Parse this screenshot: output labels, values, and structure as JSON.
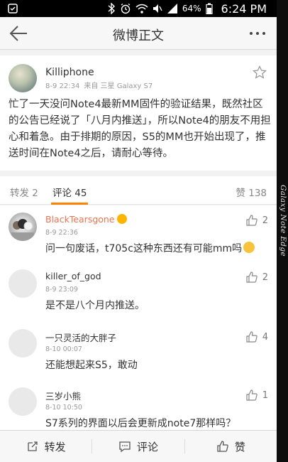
{
  "status_bar": {
    "battery": "64%",
    "time": "6:24 PM"
  },
  "header": {
    "title": "微博正文"
  },
  "post": {
    "author": "Killiphone",
    "time": "8-9 22:34",
    "source": "来自 三星 Galaxy S7",
    "text": "忙了一天没问Note4最新MM固件的验证结果，既然社区的公告已经说了「八月内推送」，所以Note4的朋友不用担心和着急。由于排期的原因，S5的MM也开始出现了，推送时间在Note4之后，请耐心等待。"
  },
  "tabs": {
    "repost": "转发 2",
    "comment": "评论 45",
    "likes": "赞 138"
  },
  "comments": [
    {
      "name": "BlackTearsgone",
      "time": "8-9 22:36",
      "text": "问一句废话，t705c这种东西还有可能mm吗",
      "likes": "2"
    },
    {
      "name": "killer_of_god",
      "time": "8-9 23:09",
      "text": "是不是八个月内推送。",
      "likes": "2"
    },
    {
      "name": "一只灵活的大胖子",
      "time": "8-10 00:07",
      "text": "还能想起来S5，敢动",
      "likes": "4"
    },
    {
      "name": "三岁小熊",
      "time": "8-10 10:50",
      "text": "S7系列的界面以后会更新成note7那样吗？",
      "likes": "1"
    }
  ],
  "bottom_bar": {
    "repost": "转发",
    "comment": "评论",
    "like": "赞"
  },
  "edge_label": "Galaxy Note Edge",
  "colors": {
    "accent": "#ff8200",
    "vip_name": "#eb7350"
  }
}
